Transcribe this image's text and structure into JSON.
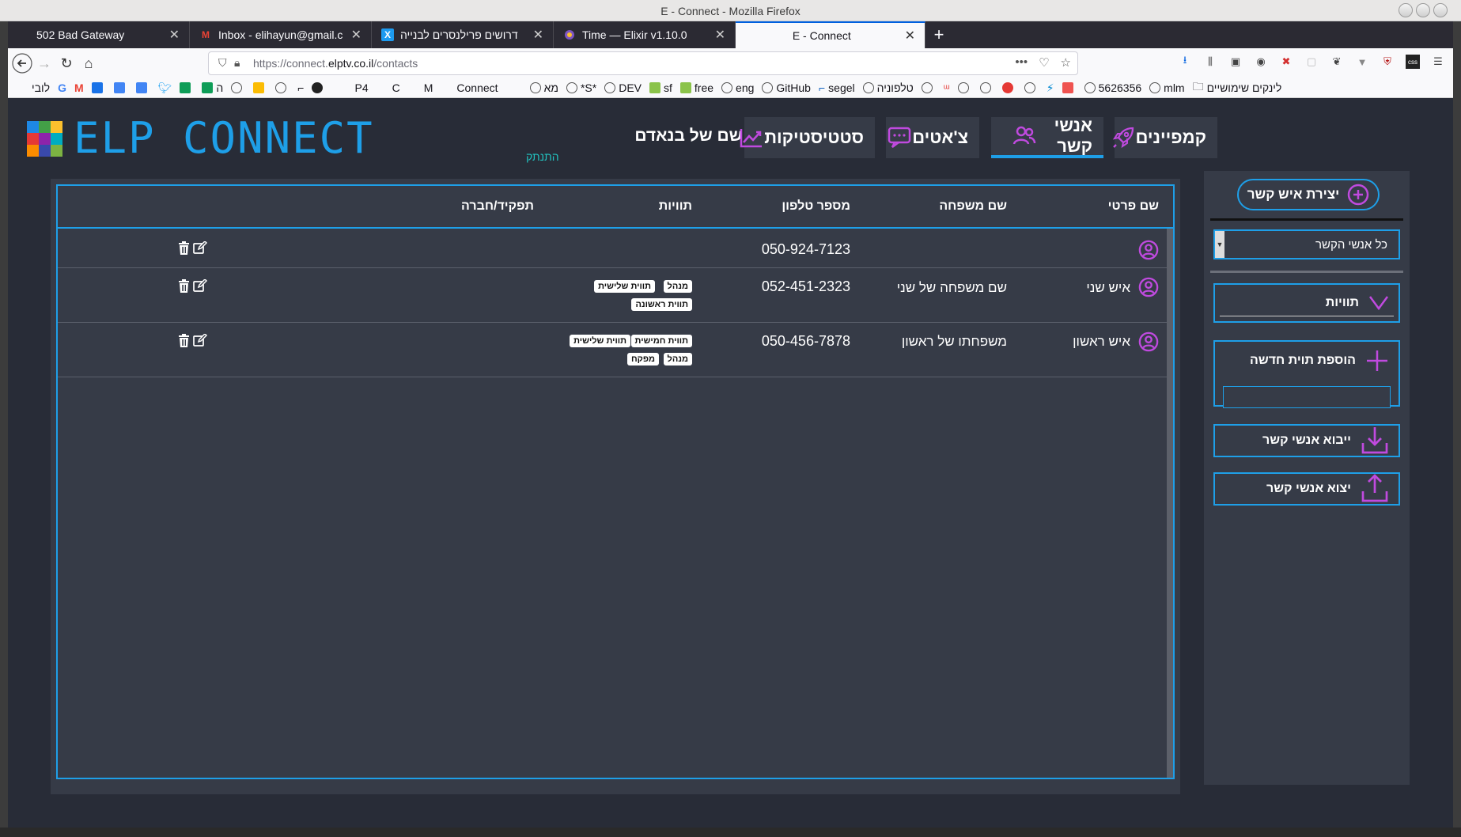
{
  "browser": {
    "window_title": "E - Connect - Mozilla Firefox",
    "tabs": [
      {
        "label": "502 Bad Gateway",
        "icon": "blank"
      },
      {
        "label": "Inbox - elihayun@gmail.c",
        "icon": "gmail-icon"
      },
      {
        "label": "דרושים פרילנסרים לבנייה",
        "icon": "x-logo-icon"
      },
      {
        "label": "Time — Elixir v1.10.0",
        "icon": "elixir-icon"
      },
      {
        "label": "E - Connect",
        "icon": "blank",
        "active": true
      }
    ],
    "url_secure_prefix": "https://connect.",
    "url_domain": "elptv.co.il",
    "url_path": "/contacts",
    "bookmarks_folder": "לינקים שימושיים",
    "bookmarks": [
      "mlm",
      "5626356",
      "טלפוניה",
      "segel",
      "GitHub",
      "eng",
      "free",
      "sf",
      "DEV",
      "*S*",
      "מא",
      "Connect",
      "M",
      "C",
      "P4",
      "לובי"
    ]
  },
  "app": {
    "logo_text": "ELP CONNECT",
    "logo_colors": [
      "#1e88e5",
      "#43a047",
      "#fbc02d",
      "#e53935",
      "#8e24aa",
      "#00acc1",
      "#fb8c00",
      "#3949ab",
      "#7cb342"
    ],
    "accent_color": "#1e9fe8",
    "icon_color": "#c04adf",
    "nav": {
      "campaigns": "קמפיינים",
      "contacts": "אנשי קשר",
      "chats": "צ'אטים",
      "stats": "סטטיסטיקות"
    },
    "user": {
      "name": "משפחה שלו שם של בנאדם",
      "logout": "התנתק"
    },
    "table": {
      "headers": {
        "first_name": "שם פרטי",
        "last_name": "שם משפחה",
        "phone": "מספר טלפון",
        "tags": "תוויות",
        "role": "תפקיד/חברה"
      },
      "rows": [
        {
          "first_name": "",
          "last_name": "",
          "phone": "050-924-7123",
          "tags": []
        },
        {
          "first_name": "איש שני",
          "last_name": "שם משפחה של שני",
          "phone": "052-451-2323",
          "tags": [
            "מנהל",
            "תווית שלישית",
            "תווית ראשונה"
          ]
        },
        {
          "first_name": "איש ראשון",
          "last_name": "משפחתו של ראשון",
          "phone": "050-456-7878",
          "tags": [
            "תווית חמישית",
            "תווית שלישית",
            "מנהל",
            "מפקח"
          ]
        }
      ]
    },
    "sidebar": {
      "create_contact": "יצירת איש קשר",
      "filter_selected": "כל אנשי הקשר",
      "tags_label": "תוויות",
      "add_tag_label": "הוספת תוית חדשה",
      "add_tag_value": "",
      "import_label": "ייבוא אנשי קשר",
      "export_label": "יצוא אנשי קשר"
    }
  }
}
